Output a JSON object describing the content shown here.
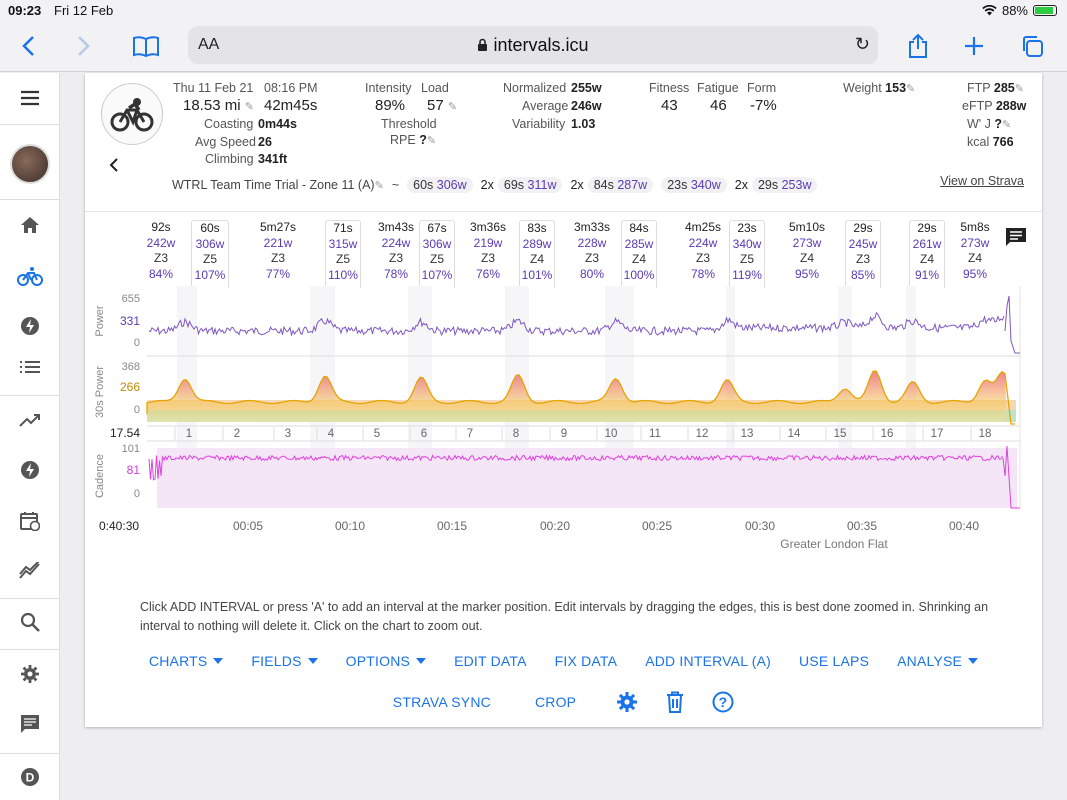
{
  "status": {
    "time": "09:23",
    "date": "Fri 12 Feb",
    "battery": "88%"
  },
  "browser": {
    "aa": "AA",
    "url": "intervals.icu"
  },
  "activity": {
    "date": "Thu 11 Feb 21",
    "time": "08:16 PM",
    "distance": "18.53 mi",
    "duration": "42m45s",
    "coasting_label": "Coasting",
    "coasting": "0m44s",
    "avgspeed_label": "Avg Speed",
    "avgspeed": "26",
    "climbing_label": "Climbing",
    "climbing": "341ft",
    "intensity_label": "Intensity",
    "intensity": "89%",
    "load_label": "Load",
    "load": "57",
    "threshold_label": "Threshold",
    "rpe_label": "RPE",
    "rpe": "?",
    "np_label": "Normalized",
    "np": "255w",
    "avg_label": "Average",
    "avg": "246w",
    "var_label": "Variability",
    "var": "1.03",
    "fitness_label": "Fitness",
    "fitness": "43",
    "fatigue_label": "Fatigue",
    "fatigue": "46",
    "form_label": "Form",
    "form": "-7%",
    "weight_label": "Weight",
    "weight": "153",
    "ftp_label": "FTP",
    "ftp": "285",
    "eftp_label": "eFTP",
    "eftp": "288w",
    "wj_label": "W' J",
    "wj": "?",
    "kcal_label": "kcal",
    "kcal": "766",
    "title": "WTRL Team Time Trial - Zone 11 (A)",
    "tilde": "~",
    "efforts": [
      {
        "count": "",
        "dur": "60s",
        "w": "306w"
      },
      {
        "count": "2x",
        "dur": "69s",
        "w": "311w"
      },
      {
        "count": "2x",
        "dur": "84s",
        "w": "287w"
      },
      {
        "count": "",
        "dur": "23s",
        "w": "340w"
      },
      {
        "count": "2x",
        "dur": "29s",
        "w": "253w"
      }
    ],
    "strava_link": "View on Strava"
  },
  "intervals": [
    {
      "dur": "92s",
      "w": "242w",
      "z": "Z3",
      "p": "84%",
      "hl": false
    },
    {
      "dur": "60s",
      "w": "306w",
      "z": "Z5",
      "p": "107%",
      "hl": true
    },
    {
      "dur": "5m27s",
      "w": "221w",
      "z": "Z3",
      "p": "77%",
      "hl": false
    },
    {
      "dur": "71s",
      "w": "315w",
      "z": "Z5",
      "p": "110%",
      "hl": true
    },
    {
      "dur": "3m43s",
      "w": "224w",
      "z": "Z3",
      "p": "78%",
      "hl": false
    },
    {
      "dur": "67s",
      "w": "306w",
      "z": "Z5",
      "p": "107%",
      "hl": true
    },
    {
      "dur": "3m36s",
      "w": "219w",
      "z": "Z3",
      "p": "76%",
      "hl": false
    },
    {
      "dur": "83s",
      "w": "289w",
      "z": "Z4",
      "p": "101%",
      "hl": true
    },
    {
      "dur": "3m33s",
      "w": "228w",
      "z": "Z3",
      "p": "80%",
      "hl": false
    },
    {
      "dur": "84s",
      "w": "285w",
      "z": "Z4",
      "p": "100%",
      "hl": true
    },
    {
      "dur": "4m25s",
      "w": "224w",
      "z": "Z3",
      "p": "78%",
      "hl": false
    },
    {
      "dur": "23s",
      "w": "340w",
      "z": "Z5",
      "p": "119%",
      "hl": true
    },
    {
      "dur": "5m10s",
      "w": "273w",
      "z": "Z4",
      "p": "95%",
      "hl": false
    },
    {
      "dur": "29s",
      "w": "245w",
      "z": "Z3",
      "p": "85%",
      "hl": true
    },
    {
      "dur": "29s",
      "w": "261w",
      "z": "Z4",
      "p": "91%",
      "hl": true
    },
    {
      "dur": "5m8s",
      "w": "273w",
      "z": "Z4",
      "p": "95%",
      "hl": false
    }
  ],
  "charts": {
    "power_label": "Power",
    "power_ticks": [
      "655",
      "331",
      "0"
    ],
    "p30_label": "30s Power",
    "p30_ticks": [
      "368",
      "266",
      "0"
    ],
    "lap_start": "17.54",
    "laps": [
      "1",
      "2",
      "3",
      "4",
      "5",
      "6",
      "7",
      "8",
      "9",
      "10",
      "11",
      "12",
      "13",
      "14",
      "15",
      "16",
      "17",
      "18"
    ],
    "cad_label": "Cadence",
    "cad_ticks": [
      "101",
      "81",
      "0"
    ],
    "time_start": "0:40:30",
    "time_ticks": [
      "00:05",
      "00:10",
      "00:15",
      "00:20",
      "00:25",
      "00:30",
      "00:35",
      "00:40"
    ],
    "route": "Greater London Flat"
  },
  "help_text": "Click ADD INTERVAL or press 'A' to add an interval at the marker position. Edit intervals by dragging the edges, this is best done zoomed in. Shrinking an interval to nothing will delete it. Click on the chart to zoom out.",
  "buttons": {
    "charts": "CHARTS",
    "fields": "FIELDS",
    "options": "OPTIONS",
    "edit": "EDIT DATA",
    "fix": "FIX DATA",
    "add": "ADD INTERVAL (A)",
    "laps": "USE LAPS",
    "analyse": "ANALYSE",
    "sync": "STRAVA SYNC",
    "crop": "CROP"
  }
}
